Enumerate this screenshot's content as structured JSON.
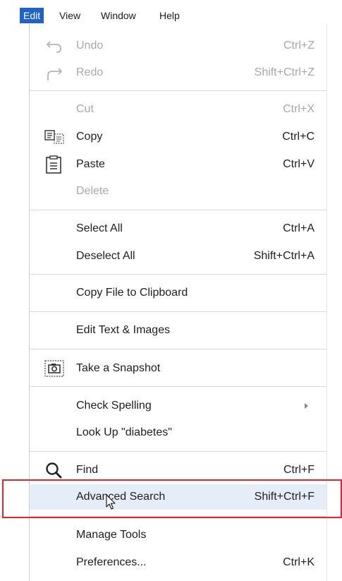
{
  "menubar": {
    "items": [
      {
        "label": "Edit",
        "active": true
      },
      {
        "label": "View"
      },
      {
        "label": "Window"
      },
      {
        "label": "Help"
      }
    ]
  },
  "menu": {
    "items": [
      {
        "label": "Undo",
        "shortcut": "Ctrl+Z",
        "icon": "undo-icon",
        "disabled": true
      },
      {
        "label": "Redo",
        "shortcut": "Shift+Ctrl+Z",
        "icon": "redo-icon",
        "disabled": true
      },
      {
        "label": "Cut",
        "shortcut": "Ctrl+X",
        "disabled": true
      },
      {
        "label": "Copy",
        "shortcut": "Ctrl+C",
        "icon": "copy-icon"
      },
      {
        "label": "Paste",
        "shortcut": "Ctrl+V",
        "icon": "paste-icon"
      },
      {
        "label": "Delete",
        "shortcut": "",
        "disabled": true
      },
      {
        "label": "Select All",
        "shortcut": "Ctrl+A"
      },
      {
        "label": "Deselect All",
        "shortcut": "Shift+Ctrl+A"
      },
      {
        "label": "Copy File to Clipboard",
        "shortcut": ""
      },
      {
        "label": "Edit Text & Images",
        "shortcut": ""
      },
      {
        "label": "Take a Snapshot",
        "shortcut": "",
        "icon": "snapshot-icon"
      },
      {
        "label": "Check Spelling",
        "shortcut": "",
        "submenu": true
      },
      {
        "label": "Look Up \"diabetes\"",
        "shortcut": ""
      },
      {
        "label": "Find",
        "shortcut": "Ctrl+F",
        "icon": "search-icon"
      },
      {
        "label": "Advanced Search",
        "shortcut": "Shift+Ctrl+F",
        "highlighted": true
      },
      {
        "label": "Manage Tools",
        "shortcut": ""
      },
      {
        "label": "Preferences...",
        "shortcut": "Ctrl+K"
      }
    ]
  }
}
